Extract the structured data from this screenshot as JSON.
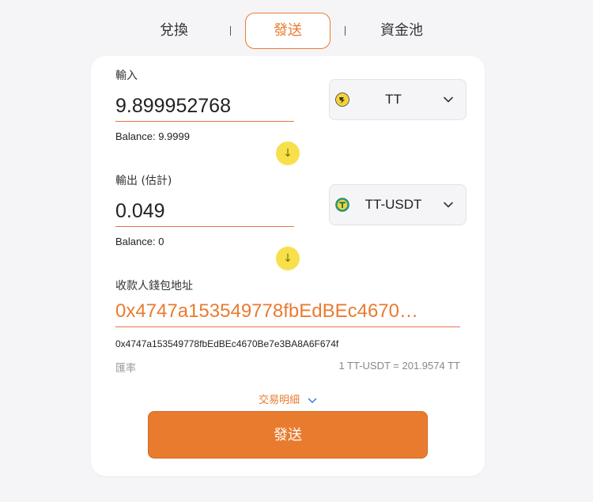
{
  "tabs": {
    "swap": "兌換",
    "send": "發送",
    "pool": "資金池"
  },
  "input": {
    "label": "輸入",
    "amount": "9.899952768",
    "balance": "Balance: 9.9999",
    "token": "TT",
    "token_icon": "thundercore-icon"
  },
  "output": {
    "label": "輸出 (估計)",
    "amount": "0.049",
    "balance": "Balance: 0",
    "token": "TT-USDT",
    "token_icon": "tether-icon"
  },
  "recipient": {
    "label": "收款人錢包地址",
    "address_display": "0x4747a153549778fbEdBEc4670…",
    "address_full": "0x4747a153549778fbEdBEc4670Be7e3BA8A6F674f"
  },
  "rate": {
    "label": "匯率",
    "value": "1 TT-USDT = 201.9574 TT"
  },
  "details": {
    "label": "交易明細"
  },
  "send_button": {
    "label": "發送"
  },
  "colors": {
    "accent": "#e97b2f",
    "arrow_button": "#f7e04a",
    "background": "#f5f5f7"
  }
}
